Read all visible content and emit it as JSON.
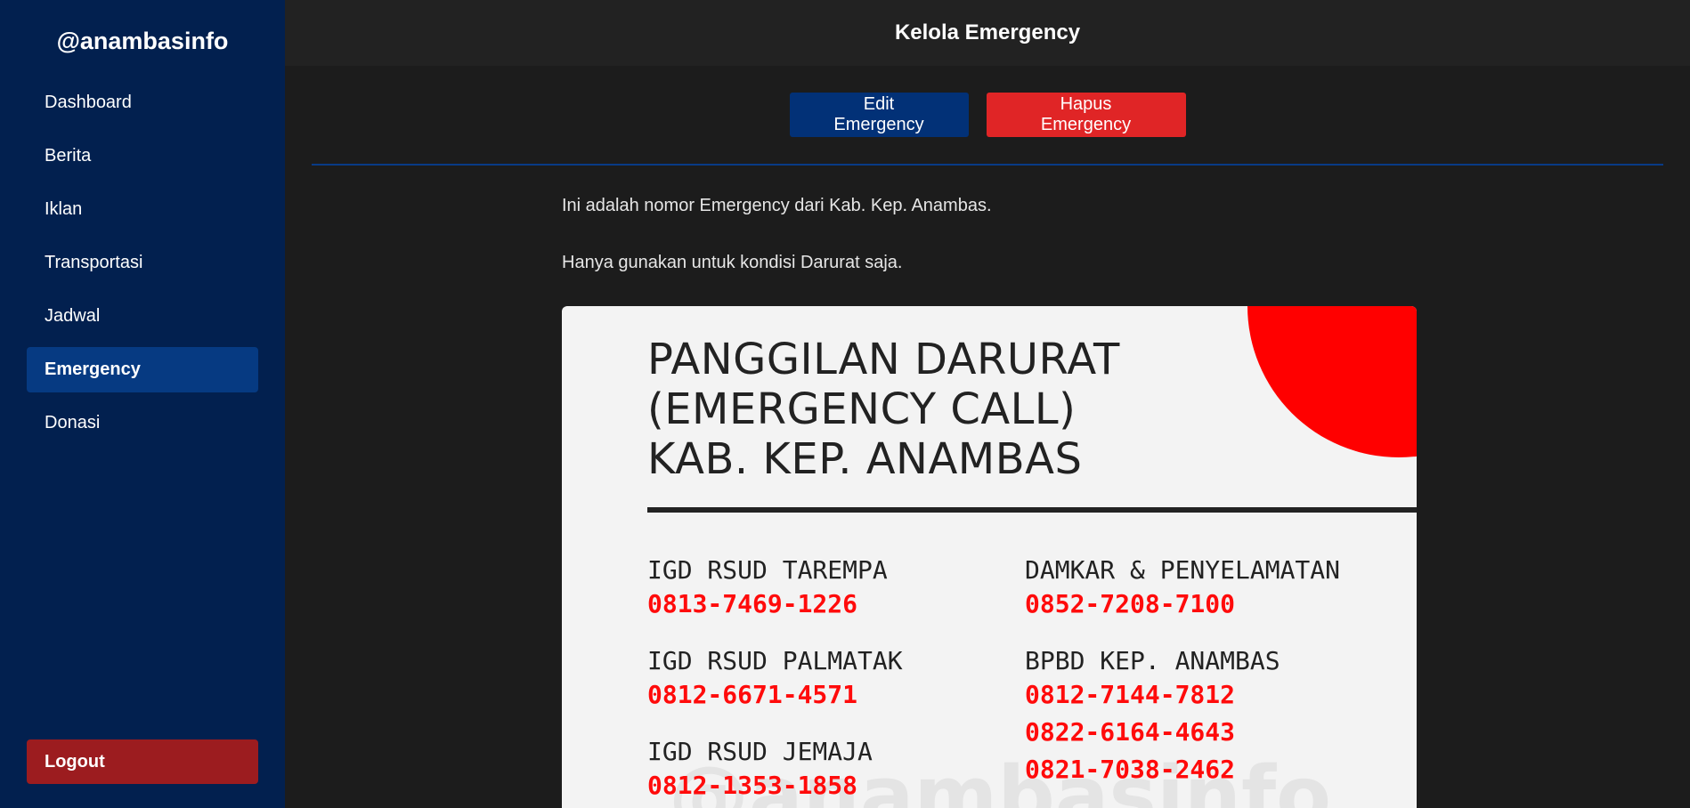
{
  "sidebar": {
    "brand": "@anambasinfo",
    "items": [
      {
        "label": "Dashboard"
      },
      {
        "label": "Berita"
      },
      {
        "label": "Iklan"
      },
      {
        "label": "Transportasi"
      },
      {
        "label": "Jadwal"
      },
      {
        "label": "Emergency"
      },
      {
        "label": "Donasi"
      }
    ],
    "logout_label": "Logout"
  },
  "header": {
    "title": "Kelola Emergency"
  },
  "actions": {
    "edit_label": "Edit Emergency",
    "delete_label": "Hapus Emergency"
  },
  "content": {
    "line1": "Ini adalah nomor Emergency dari Kab. Kep. Anambas.",
    "line2": "Hanya gunakan untuk kondisi Darurat saja."
  },
  "poster": {
    "title_line1": "PANGGILAN DARURAT",
    "title_line2": "(EMERGENCY CALL)",
    "title_line3": "KAB. KEP. ANAMBAS",
    "left": [
      {
        "label": "IGD RSUD TAREMPA",
        "numbers": [
          "0813-7469-1226"
        ]
      },
      {
        "label": "IGD RSUD PALMATAK",
        "numbers": [
          "0812-6671-4571"
        ]
      },
      {
        "label": "IGD RSUD JEMAJA",
        "numbers": [
          "0812-1353-1858"
        ]
      }
    ],
    "right": [
      {
        "label": "DAMKAR & PENYELAMATAN",
        "numbers": [
          "0852-7208-7100"
        ]
      },
      {
        "label": "BPBD KEP. ANAMBAS",
        "numbers": [
          "0812-7144-7812",
          "0822-6164-4643",
          "0821-7038-2462"
        ]
      }
    ],
    "watermark": "@anambasinfo",
    "colors": {
      "accent": "#ff0000",
      "number": "#ff0b0b"
    }
  }
}
